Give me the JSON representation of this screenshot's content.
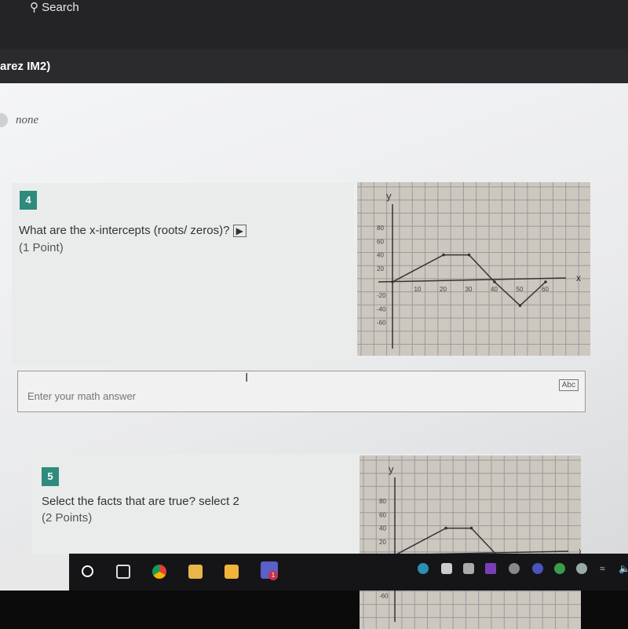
{
  "topbar": {
    "search_label": "Search"
  },
  "header": {
    "title": "arez IM2)"
  },
  "prev_option": {
    "label": "none"
  },
  "questions": [
    {
      "number": "4",
      "text": "What are the x-intercepts (roots/ zeros)?",
      "points": "(1 Point)",
      "immersive_reader_icon": "immersive-reader-icon"
    },
    {
      "number": "5",
      "text": "Select the facts that are true? select 2",
      "points": "(2 Points)"
    }
  ],
  "answer": {
    "placeholder": "Enter your math answer",
    "mode_label": "Abc"
  },
  "graph": {
    "x_label": "x",
    "y_label": "y",
    "x_ticks": [
      "10",
      "20",
      "30",
      "40",
      "50",
      "60"
    ],
    "y_ticks": [
      "80",
      "60",
      "40",
      "20",
      "-20",
      "-40",
      "-60"
    ],
    "points": [
      [
        0,
        0
      ],
      [
        20,
        40
      ],
      [
        30,
        40
      ],
      [
        40,
        0
      ],
      [
        50,
        -35
      ],
      [
        60,
        0
      ]
    ]
  },
  "taskbar": {
    "icons": [
      "start-icon",
      "task-view-icon",
      "chrome-icon",
      "file-explorer-icon",
      "store-icon",
      "teams-icon"
    ],
    "teams_badge": "1",
    "tray_icons": [
      "edge-icon",
      "app-icon",
      "outlook-icon",
      "onenote-icon",
      "onedrive-icon",
      "teams-icon",
      "defender-icon",
      "security-icon",
      "wifi-icon",
      "volume-icon"
    ]
  },
  "colors": {
    "badge": "#2e8b7e"
  }
}
